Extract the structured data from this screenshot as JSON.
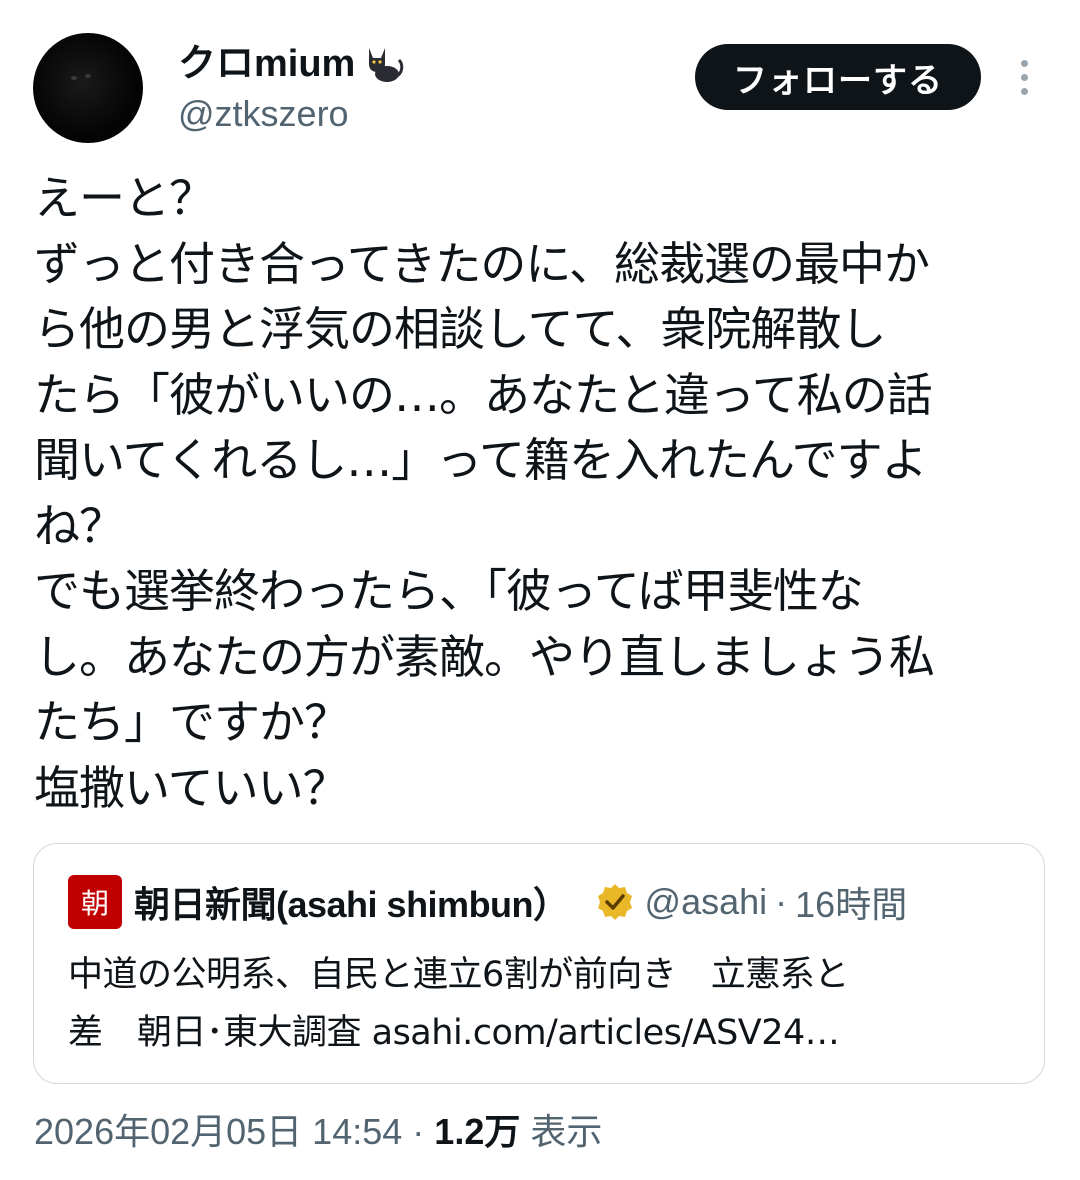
{
  "author": {
    "display_name": "クロmium",
    "handle": "@ztkszero",
    "avatar_icon": "black-cat-avatar",
    "name_emoji_icon": "black-cat-icon"
  },
  "follow_button": {
    "label": "フォローする"
  },
  "more_icon": "more-vertical-icon",
  "tweet": {
    "lines": [
      "えーと？",
      "ずっと付き合ってきたのに、総裁選の最中か",
      "ら他の男と浮気の相談してて、衆院解散し",
      "たら「彼がいいの…。あなたと違って私の話",
      "聞いてくれるし…」って籍を入れたんですよ",
      "ね？",
      "でも選挙終わったら、「彼ってば甲斐性な",
      "し。あなたの方が素敵。やり直しましょう私",
      "たち」ですか？",
      "塩撒いていい？"
    ]
  },
  "quote": {
    "logo_text": "朝",
    "logo_color": "#c00000",
    "name": "朝日新聞(asahi shimbun）",
    "verified_icon": "gold-verified-badge-icon",
    "handle": "@asahi",
    "separator": "·",
    "time": "16時間",
    "body_lines": [
      "中道の公明系、自民と連立6割が前向き　立憲系と",
      "差　朝日･東大調査 asahi.com/articles/ASV24…"
    ]
  },
  "meta": {
    "datetime": "2026年02月05日 14:54",
    "separator": "·",
    "views_count": "1.2万",
    "views_label": "表示"
  }
}
